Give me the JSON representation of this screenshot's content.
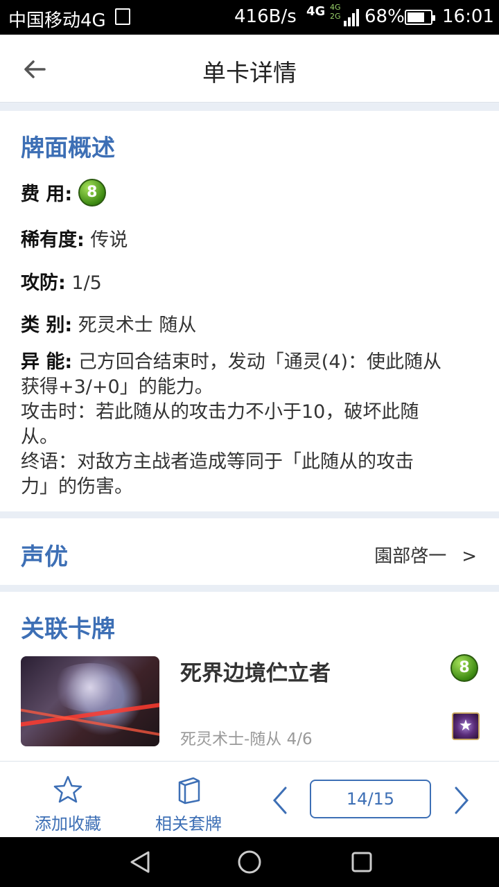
{
  "status_bar": {
    "carrier": "中国移动4G",
    "speed": "416B/s",
    "network": "4G",
    "network_small": "4G 2G",
    "battery": "68%",
    "time": "16:01"
  },
  "header": {
    "title": "单卡详情",
    "back_icon": "arrow-left-icon"
  },
  "overview": {
    "section_title": "牌面概述",
    "cost_label": "费 用:",
    "cost_value": "8",
    "rarity_label": "稀有度:",
    "rarity_value": "传说",
    "stats_label": "攻防:",
    "stats_value": "1/5",
    "type_label": "类 别:",
    "type_value": "死灵术士 随从",
    "ability_label": "异 能:",
    "ability_lines": [
      "己方回合结束时，发动「通灵(4)：使此随从",
      "获得+3/+0」的能力。",
      "攻击时：若此随从的攻击力不小于10，破坏此随",
      "从。",
      "终语：对敌方主战者造成等同于「此随从的攻击",
      "力」的伤害。"
    ]
  },
  "voice": {
    "section_title": "声优",
    "actor": "園部啓一",
    "chevron": ">"
  },
  "related": {
    "section_title": "关联卡牌",
    "cards": [
      {
        "name": "死界边境伫立者",
        "meta": "死灵术士-随从  4/6",
        "cost": "8",
        "rarity_icon": "star-badge-icon"
      }
    ]
  },
  "bottom_bar": {
    "favorite_label": "添加收藏",
    "deck_label": "相关套牌",
    "page": "14/15"
  },
  "colors": {
    "accent": "#3d6fb5",
    "background": "#e9eef5"
  }
}
